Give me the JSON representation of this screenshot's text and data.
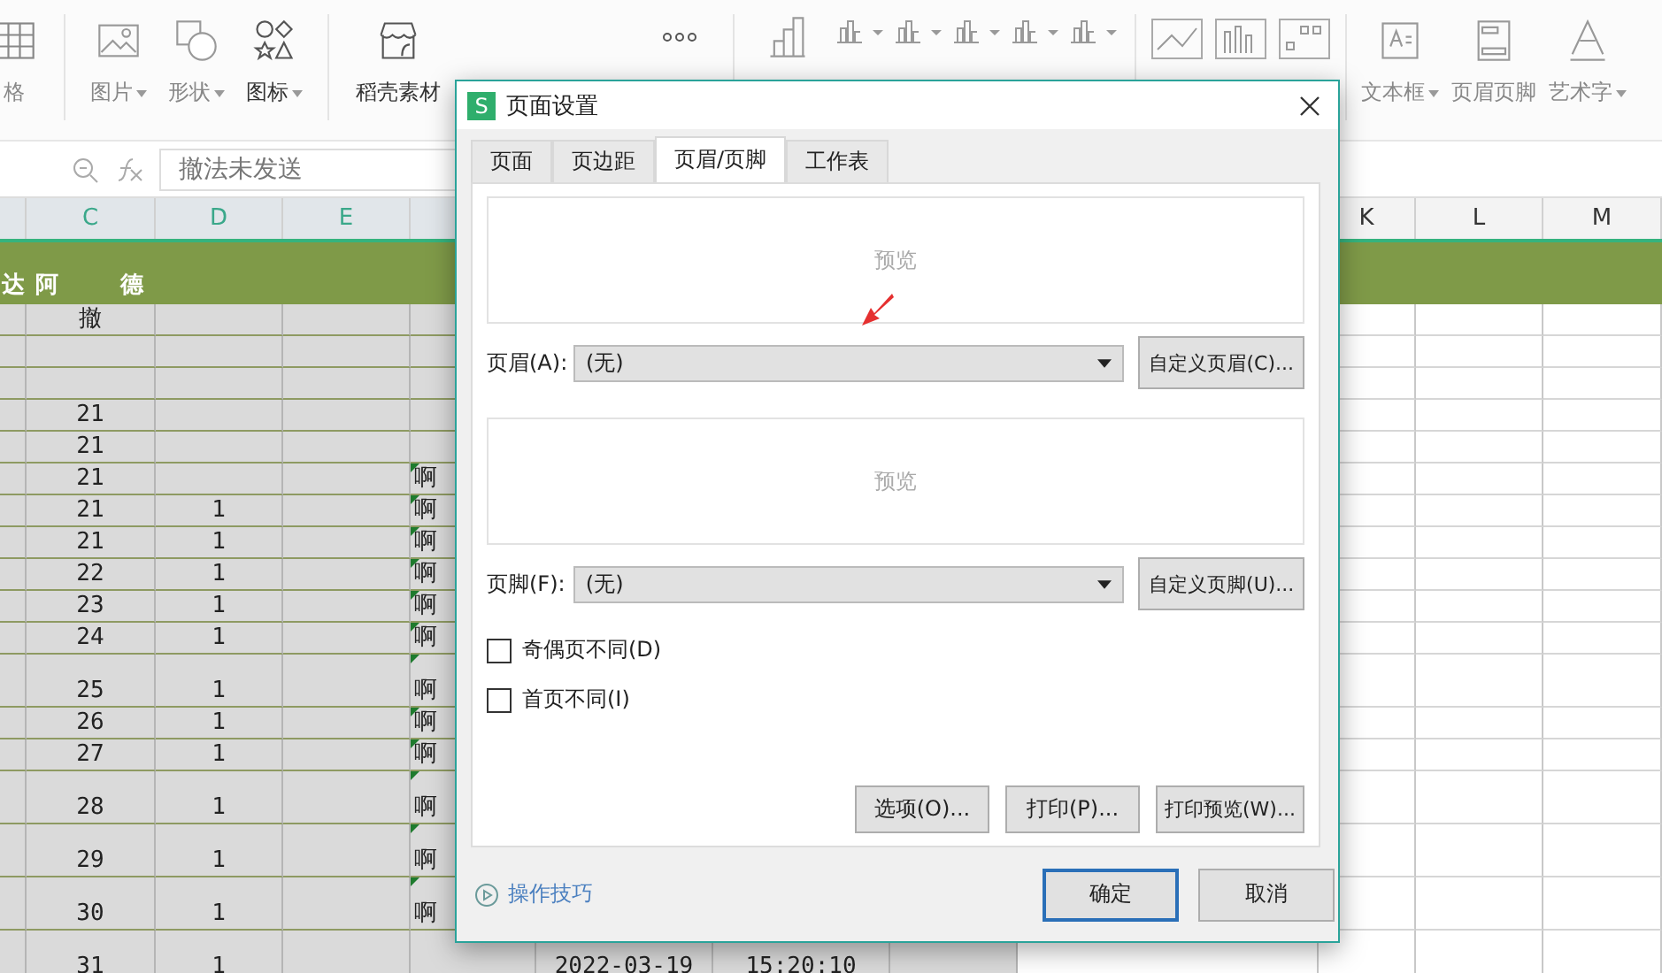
{
  "toolbar": {
    "items": [
      {
        "label": "格",
        "dropdown": false
      },
      {
        "label": "图片",
        "dropdown": true
      },
      {
        "label": "形状",
        "dropdown": true
      },
      {
        "label": "图标",
        "dropdown": true
      },
      {
        "label": "稻壳素材",
        "dropdown": false
      },
      {
        "label": "文本框",
        "dropdown": true
      },
      {
        "label": "页眉页脚",
        "dropdown": false
      },
      {
        "label": "艺术字",
        "dropdown": true
      }
    ]
  },
  "formula_bar": {
    "value": "撤法未发送"
  },
  "sheet": {
    "column_headers": [
      "C",
      "D",
      "E",
      "K",
      "L",
      "M"
    ],
    "title_band": [
      "达",
      "阿",
      "德"
    ],
    "rows": [
      {
        "C": "撤"
      },
      {},
      {},
      {
        "C": "21"
      },
      {
        "C": "21"
      },
      {
        "C": "21",
        "column_6": "啊",
        "flagged": true
      },
      {
        "C": "21",
        "D": "1",
        "column_6": "啊",
        "flagged": true
      },
      {
        "C": "21",
        "D": "1",
        "column_6": "啊",
        "flagged": true
      },
      {
        "C": "22",
        "D": "1",
        "column_6": "啊",
        "flagged": true
      },
      {
        "C": "23",
        "D": "1",
        "column_6": "啊",
        "flagged": true
      },
      {
        "C": "24",
        "D": "1",
        "column_6": "啊",
        "flagged": true
      },
      {
        "C": "25",
        "D": "1",
        "column_6": "啊",
        "flagged": true
      },
      {
        "C": "26",
        "D": "1",
        "column_6": "啊",
        "flagged": true
      },
      {
        "C": "27",
        "D": "1",
        "column_6": "啊",
        "flagged": true
      },
      {
        "C": "28",
        "D": "1",
        "column_6": "啊",
        "flagged": true
      },
      {
        "C": "29",
        "D": "1",
        "column_6": "啊",
        "flagged": true
      },
      {
        "C": "30",
        "D": "1",
        "column_6": "啊",
        "flagged": true
      },
      {
        "C": "31",
        "D": "1",
        "column_7": "2022-03-19",
        "column_8": "15:20:10"
      }
    ]
  },
  "dialog": {
    "logo": "S",
    "title": "页面设置",
    "tabs": [
      {
        "label": "页面",
        "selected": false
      },
      {
        "label": "页边距",
        "selected": false
      },
      {
        "label": "页眉/页脚",
        "selected": true
      },
      {
        "label": "工作表",
        "selected": false
      }
    ],
    "header_preview": "预览",
    "header_label": "页眉(A):",
    "header_value": "(无)",
    "header_button": "自定义页眉(C)...",
    "footer_preview": "预览",
    "footer_label": "页脚(F):",
    "footer_value": "(无)",
    "footer_button": "自定义页脚(U)...",
    "checkboxes": [
      {
        "label": "奇偶页不同(D)",
        "checked": false
      },
      {
        "label": "首页不同(I)",
        "checked": false
      }
    ],
    "action_buttons": [
      "选项(O)...",
      "打印(P)...",
      "打印预览(W)..."
    ],
    "tips_link": "操作技巧",
    "ok_button": "确定",
    "cancel_button": "取消"
  }
}
